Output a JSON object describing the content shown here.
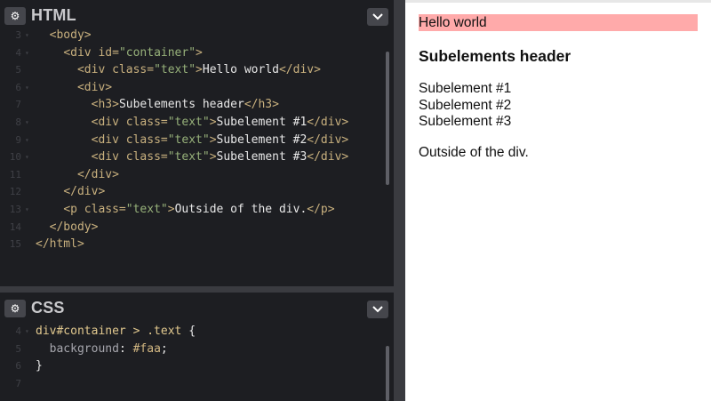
{
  "html_panel": {
    "title": "HTML",
    "lines": [
      {
        "num": "3",
        "fold": true,
        "indent": "  ",
        "parts": [
          [
            "tag",
            "<body>"
          ]
        ]
      },
      {
        "num": "4",
        "fold": true,
        "indent": "    ",
        "parts": [
          [
            "tag",
            "<div "
          ],
          [
            "attr",
            "id="
          ],
          [
            "str",
            "\"container\""
          ],
          [
            "tag",
            ">"
          ]
        ]
      },
      {
        "num": "5",
        "fold": false,
        "indent": "      ",
        "parts": [
          [
            "tag",
            "<div "
          ],
          [
            "attr",
            "class="
          ],
          [
            "str",
            "\"text\""
          ],
          [
            "tag",
            ">"
          ],
          [
            "plain",
            "Hello world"
          ],
          [
            "tag",
            "</div>"
          ]
        ]
      },
      {
        "num": "6",
        "fold": true,
        "indent": "      ",
        "parts": [
          [
            "tag",
            "<div>"
          ]
        ]
      },
      {
        "num": "7",
        "fold": false,
        "indent": "        ",
        "parts": [
          [
            "tag",
            "<h3>"
          ],
          [
            "plain",
            "Subelements header"
          ],
          [
            "tag",
            "</h3>"
          ]
        ]
      },
      {
        "num": "8",
        "fold": true,
        "indent": "        ",
        "parts": [
          [
            "tag",
            "<div "
          ],
          [
            "attr",
            "class="
          ],
          [
            "str",
            "\"text\""
          ],
          [
            "tag",
            ">"
          ],
          [
            "plain",
            "Subelement #1"
          ],
          [
            "tag",
            "</div>"
          ]
        ]
      },
      {
        "num": "9",
        "fold": true,
        "indent": "        ",
        "parts": [
          [
            "tag",
            "<div "
          ],
          [
            "attr",
            "class="
          ],
          [
            "str",
            "\"text\""
          ],
          [
            "tag",
            ">"
          ],
          [
            "plain",
            "Subelement #2"
          ],
          [
            "tag",
            "</div>"
          ]
        ]
      },
      {
        "num": "10",
        "fold": true,
        "indent": "        ",
        "parts": [
          [
            "tag",
            "<div "
          ],
          [
            "attr",
            "class="
          ],
          [
            "str",
            "\"text\""
          ],
          [
            "tag",
            ">"
          ],
          [
            "plain",
            "Subelement #3"
          ],
          [
            "tag",
            "</div>"
          ]
        ]
      },
      {
        "num": "11",
        "fold": false,
        "indent": "      ",
        "parts": [
          [
            "tag",
            "</div>"
          ]
        ]
      },
      {
        "num": "12",
        "fold": false,
        "indent": "    ",
        "parts": [
          [
            "tag",
            "</div>"
          ]
        ]
      },
      {
        "num": "13",
        "fold": true,
        "indent": "    ",
        "parts": [
          [
            "tag",
            "<p "
          ],
          [
            "attr",
            "class="
          ],
          [
            "str",
            "\"text\""
          ],
          [
            "tag",
            ">"
          ],
          [
            "plain",
            "Outside of the div."
          ],
          [
            "tag",
            "</p>"
          ]
        ]
      },
      {
        "num": "14",
        "fold": false,
        "indent": "  ",
        "parts": [
          [
            "tag",
            "</body>"
          ]
        ]
      },
      {
        "num": "15",
        "fold": false,
        "indent": "",
        "parts": [
          [
            "tag",
            "</html>"
          ]
        ]
      }
    ]
  },
  "css_panel": {
    "title": "CSS",
    "lines": [
      {
        "num": "4",
        "fold": true,
        "indent": "",
        "parts": [
          [
            "sel",
            "div#container > .text "
          ],
          [
            "plain",
            "{"
          ]
        ]
      },
      {
        "num": "5",
        "fold": false,
        "indent": "  ",
        "parts": [
          [
            "prop",
            "background"
          ],
          [
            "plain",
            ": "
          ],
          [
            "val",
            "#faa"
          ],
          [
            "plain",
            ";"
          ]
        ]
      },
      {
        "num": "6",
        "fold": false,
        "indent": "",
        "parts": [
          [
            "plain",
            "}"
          ]
        ]
      },
      {
        "num": "7",
        "fold": false,
        "indent": "",
        "parts": []
      }
    ]
  },
  "preview": {
    "hello": "Hello world",
    "header": "Subelements header",
    "sub1": "Subelement #1",
    "sub2": "Subelement #2",
    "sub3": "Subelement #3",
    "outside": "Outside of the div."
  },
  "icons": {
    "settings": "gear-icon",
    "collapse": "chevron-down-icon"
  },
  "colors": {
    "highlight_bg": "#ffaaaa",
    "editor_bg": "#1d1e22"
  }
}
